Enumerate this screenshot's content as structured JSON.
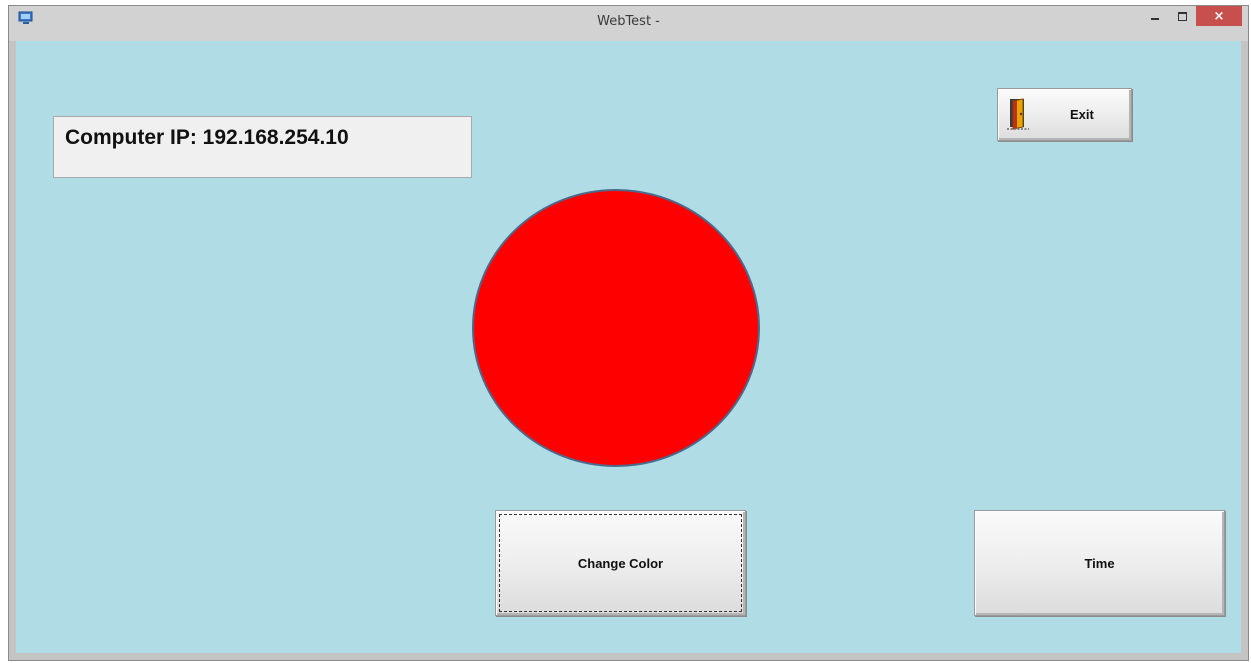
{
  "window": {
    "title": "WebTest -",
    "close_glyph": "×"
  },
  "ip_panel": {
    "text": "Computer IP: 192.168.254.10"
  },
  "indicator": {
    "color": "#ff0000",
    "outline_color": "#4a6a8c"
  },
  "buttons": {
    "exit_label": "Exit",
    "change_color_label": "Change Color",
    "time_label": "Time"
  },
  "colors": {
    "client_background": "#b0dce6",
    "close_button": "#c7504f"
  },
  "icons": {
    "app": "app-icon",
    "exit": "exit-door-icon"
  }
}
